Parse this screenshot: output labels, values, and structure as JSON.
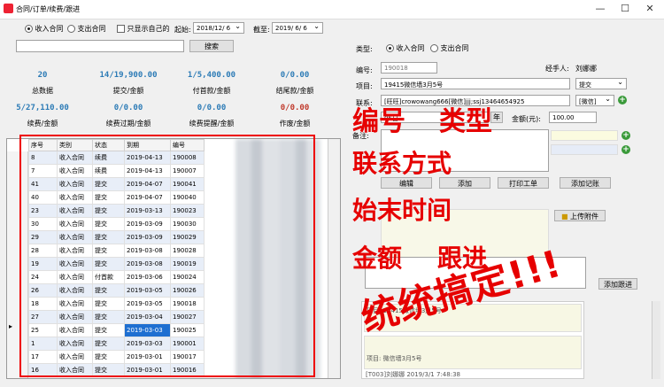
{
  "window": {
    "title": "合同/订单/续费/跟进",
    "minimize": "—",
    "maximize": "☐",
    "close": "✕"
  },
  "filter": {
    "radio_income": "收入合同",
    "radio_expense": "支出合同",
    "only_mine": "只显示自己的",
    "start_label": "起始:",
    "start_value": "2018/12/ 6",
    "end_label": "截至:",
    "end_value": "2019/ 6/ 6",
    "search_button": "搜索"
  },
  "stats": [
    {
      "value": "20",
      "label": "总数据"
    },
    {
      "value": "14/19,900.00",
      "label": "提交/金额"
    },
    {
      "value": "1/5,400.00",
      "label": "付首款/金额"
    },
    {
      "value": "0/0.00",
      "label": "结尾款/金额"
    },
    {
      "value": "5/27,110.00",
      "label": "续费/金额"
    },
    {
      "value": "0/0.00",
      "label": "续费过期/金额"
    },
    {
      "value": "0/0.00",
      "label": "续费提醒/金额"
    },
    {
      "value": "0/0.00",
      "label": "作废/金额"
    }
  ],
  "table": {
    "headers": [
      "序号",
      "类别",
      "状态",
      "到期",
      "编号"
    ],
    "rows": [
      [
        "8",
        "收入合同",
        "续费",
        "2019-04-13",
        "190008"
      ],
      [
        "7",
        "收入合同",
        "续费",
        "2019-04-13",
        "190007"
      ],
      [
        "41",
        "收入合同",
        "提交",
        "2019-04-07",
        "190041"
      ],
      [
        "40",
        "收入合同",
        "提交",
        "2019-04-07",
        "190040"
      ],
      [
        "23",
        "收入合同",
        "提交",
        "2019-03-13",
        "190023"
      ],
      [
        "30",
        "收入合同",
        "提交",
        "2019-03-09",
        "190030"
      ],
      [
        "29",
        "收入合同",
        "提交",
        "2019-03-09",
        "190029"
      ],
      [
        "28",
        "收入合同",
        "提交",
        "2019-03-08",
        "190028"
      ],
      [
        "19",
        "收入合同",
        "提交",
        "2019-03-08",
        "190019"
      ],
      [
        "24",
        "收入合同",
        "付首款",
        "2019-03-06",
        "190024"
      ],
      [
        "26",
        "收入合同",
        "提交",
        "2019-03-05",
        "190026"
      ],
      [
        "18",
        "收入合同",
        "提交",
        "2019-03-05",
        "190018"
      ],
      [
        "27",
        "收入合同",
        "提交",
        "2019-03-04",
        "190027"
      ],
      [
        "25",
        "收入合同",
        "提交",
        "2019-03-03",
        "190025"
      ],
      [
        "1",
        "收入合同",
        "提交",
        "2019-03-03",
        "190001"
      ],
      [
        "17",
        "收入合同",
        "提交",
        "2019-03-01",
        "190017"
      ],
      [
        "16",
        "收入合同",
        "提交",
        "2019-03-01",
        "190016"
      ]
    ],
    "current_row_marker": "▸"
  },
  "form": {
    "type_label": "类型:",
    "type_income": "收入合同",
    "type_expense": "支出合同",
    "number_label": "编号:",
    "number_value": "190018",
    "handler_label": "经手人:",
    "handler_value": "刘娜娜",
    "project_label": "项目:",
    "project_value": "19415微信墙3月5号",
    "status_value": "提交",
    "contact_label": "联系:",
    "contact_value": "[旺旺]crowowang666[微信]jjj;ssj13464654925",
    "contact_type": "[微信]",
    "date_suffix": "年",
    "date_value": "05日",
    "amount_label": "金额(元):",
    "amount_value": "100.00",
    "remark_label": "备注:",
    "btn_edit": "编辑",
    "btn_add": "添加",
    "btn_print": "打印工单",
    "btn_renew": "添加记账",
    "btn_upload": "上传附件",
    "btn_add_followup": "添加跟进",
    "log_line1": "项目: 19415微信墙3月5号",
    "log_line2": "项目: 微信墙3月5号",
    "log_footer": "[T003]刘娜娜  2019/3/1 7:48:38"
  },
  "annotations": {
    "line1a": "编号",
    "line1b": "类型",
    "line2": "联系方式",
    "line3": "始末时间",
    "line4a": "金额",
    "line4b": "跟进",
    "slogan": "统统搞定!!!"
  },
  "colors": {
    "accent_blue": "#2c7bb6",
    "annotation_red": "#e60000",
    "selected_row": "#1e6fd1"
  }
}
